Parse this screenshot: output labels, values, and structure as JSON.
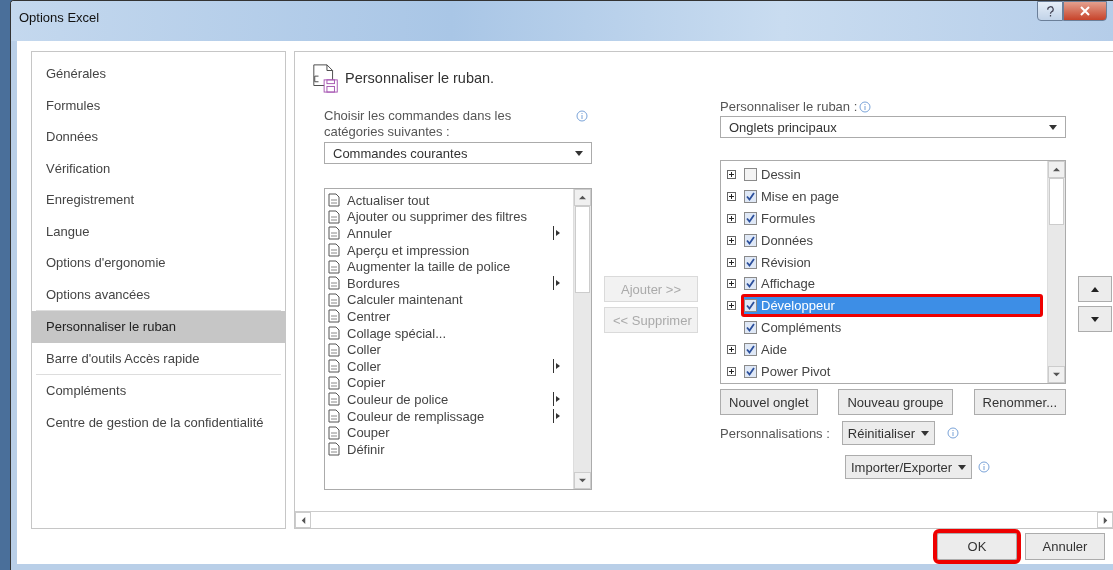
{
  "window": {
    "title": "Options Excel"
  },
  "sidebar": {
    "groups": [
      [
        {
          "label": "Générales",
          "selected": false
        },
        {
          "label": "Formules",
          "selected": false
        },
        {
          "label": "Données",
          "selected": false
        },
        {
          "label": "Vérification",
          "selected": false
        },
        {
          "label": "Enregistrement",
          "selected": false
        },
        {
          "label": "Langue",
          "selected": false
        },
        {
          "label": "Options d'ergonomie",
          "selected": false
        },
        {
          "label": "Options avancées",
          "selected": false
        }
      ],
      [
        {
          "label": "Personnaliser le ruban",
          "selected": true
        },
        {
          "label": "Barre d'outils Accès rapide",
          "selected": false
        }
      ],
      [
        {
          "label": "Compléments",
          "selected": false
        },
        {
          "label": "Centre de gestion de la confidentialité",
          "selected": false
        }
      ]
    ]
  },
  "heading": "Personnaliser le ruban.",
  "commands_source": {
    "label": "Choisir les commandes dans les catégories suivantes :",
    "value": "Commandes courantes"
  },
  "commands": [
    {
      "label": "Actualiser tout",
      "submenu": false
    },
    {
      "label": "Ajouter ou supprimer des filtres",
      "submenu": false
    },
    {
      "label": "Annuler",
      "submenu": true
    },
    {
      "label": "Aperçu et impression",
      "submenu": false
    },
    {
      "label": "Augmenter la taille de police",
      "submenu": false
    },
    {
      "label": "Bordures",
      "submenu": true
    },
    {
      "label": "Calculer maintenant",
      "submenu": false
    },
    {
      "label": "Centrer",
      "submenu": false
    },
    {
      "label": "Collage spécial...",
      "submenu": false
    },
    {
      "label": "Coller",
      "submenu": false
    },
    {
      "label": "Coller",
      "submenu": true
    },
    {
      "label": "Copier",
      "submenu": false
    },
    {
      "label": "Couleur de police",
      "submenu": true
    },
    {
      "label": "Couleur de remplissage",
      "submenu": true
    },
    {
      "label": "Couper",
      "submenu": false
    },
    {
      "label": "Définir",
      "submenu": false
    }
  ],
  "transfer_buttons": [
    {
      "label": "Ajouter >>",
      "disabled": true
    },
    {
      "label": "<< Supprimer",
      "disabled": true
    }
  ],
  "ribbon": {
    "label": "Personnaliser le ruban :",
    "value": "Onglets principaux",
    "tabs": [
      {
        "label": "Dessin",
        "expandable": true,
        "checked": false,
        "selected": false,
        "highlighted": false
      },
      {
        "label": "Mise en page",
        "expandable": true,
        "checked": true,
        "selected": false,
        "highlighted": false
      },
      {
        "label": "Formules",
        "expandable": true,
        "checked": true,
        "selected": false,
        "highlighted": false
      },
      {
        "label": "Données",
        "expandable": true,
        "checked": true,
        "selected": false,
        "highlighted": false
      },
      {
        "label": "Révision",
        "expandable": true,
        "checked": true,
        "selected": false,
        "highlighted": false
      },
      {
        "label": "Affichage",
        "expandable": true,
        "checked": true,
        "selected": false,
        "highlighted": false
      },
      {
        "label": "Développeur",
        "expandable": true,
        "checked": true,
        "selected": true,
        "highlighted": true
      },
      {
        "label": "Compléments",
        "expandable": false,
        "checked": true,
        "selected": false,
        "highlighted": false
      },
      {
        "label": "Aide",
        "expandable": true,
        "checked": true,
        "selected": false,
        "highlighted": false
      },
      {
        "label": "Power Pivot",
        "expandable": true,
        "checked": true,
        "selected": false,
        "highlighted": false
      }
    ]
  },
  "tab_buttons": [
    "Nouvel onglet",
    "Nouveau groupe",
    "Renommer..."
  ],
  "customizations": {
    "label": "Personnalisations :",
    "reset": "Réinitialiser",
    "import_export": "Importer/Exporter"
  },
  "footer_buttons": [
    {
      "label": "OK",
      "highlighted": true
    },
    {
      "label": "Annuler",
      "highlighted": false
    }
  ]
}
